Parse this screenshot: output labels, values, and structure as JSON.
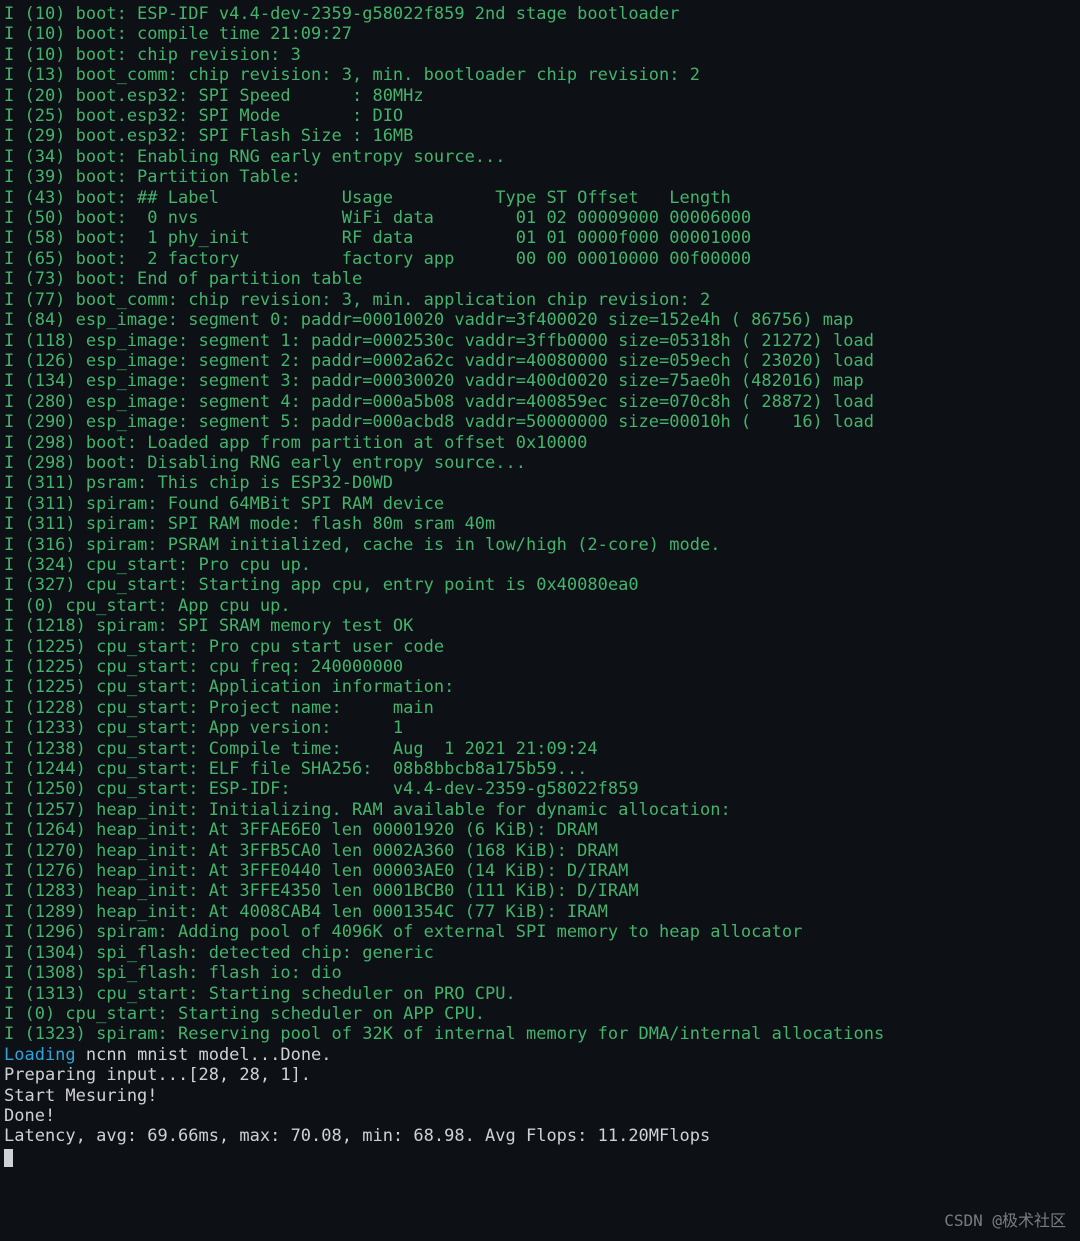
{
  "watermark": "CSDN @极术社区",
  "log": [
    {
      "c": "info",
      "t": "I (10) boot: ESP-IDF v4.4-dev-2359-g58022f859 2nd stage bootloader"
    },
    {
      "c": "info",
      "t": "I (10) boot: compile time 21:09:27"
    },
    {
      "c": "info",
      "t": "I (10) boot: chip revision: 3"
    },
    {
      "c": "info",
      "t": "I (13) boot_comm: chip revision: 3, min. bootloader chip revision: 2"
    },
    {
      "c": "info",
      "t": "I (20) boot.esp32: SPI Speed      : 80MHz"
    },
    {
      "c": "info",
      "t": "I (25) boot.esp32: SPI Mode       : DIO"
    },
    {
      "c": "info",
      "t": "I (29) boot.esp32: SPI Flash Size : 16MB"
    },
    {
      "c": "info",
      "t": "I (34) boot: Enabling RNG early entropy source..."
    },
    {
      "c": "info",
      "t": "I (39) boot: Partition Table:"
    },
    {
      "c": "info",
      "t": "I (43) boot: ## Label            Usage          Type ST Offset   Length"
    },
    {
      "c": "info",
      "t": "I (50) boot:  0 nvs              WiFi data        01 02 00009000 00006000"
    },
    {
      "c": "info",
      "t": "I (58) boot:  1 phy_init         RF data          01 01 0000f000 00001000"
    },
    {
      "c": "info",
      "t": "I (65) boot:  2 factory          factory app      00 00 00010000 00f00000"
    },
    {
      "c": "info",
      "t": "I (73) boot: End of partition table"
    },
    {
      "c": "info",
      "t": "I (77) boot_comm: chip revision: 3, min. application chip revision: 2"
    },
    {
      "c": "info",
      "t": "I (84) esp_image: segment 0: paddr=00010020 vaddr=3f400020 size=152e4h ( 86756) map"
    },
    {
      "c": "info",
      "t": "I (118) esp_image: segment 1: paddr=0002530c vaddr=3ffb0000 size=05318h ( 21272) load"
    },
    {
      "c": "info",
      "t": "I (126) esp_image: segment 2: paddr=0002a62c vaddr=40080000 size=059ech ( 23020) load"
    },
    {
      "c": "info",
      "t": "I (134) esp_image: segment 3: paddr=00030020 vaddr=400d0020 size=75ae0h (482016) map"
    },
    {
      "c": "info",
      "t": "I (280) esp_image: segment 4: paddr=000a5b08 vaddr=400859ec size=070c8h ( 28872) load"
    },
    {
      "c": "info",
      "t": "I (290) esp_image: segment 5: paddr=000acbd8 vaddr=50000000 size=00010h (    16) load"
    },
    {
      "c": "info",
      "t": "I (298) boot: Loaded app from partition at offset 0x10000"
    },
    {
      "c": "info",
      "t": "I (298) boot: Disabling RNG early entropy source..."
    },
    {
      "c": "info",
      "t": "I (311) psram: This chip is ESP32-D0WD"
    },
    {
      "c": "info",
      "t": "I (311) spiram: Found 64MBit SPI RAM device"
    },
    {
      "c": "info",
      "t": "I (311) spiram: SPI RAM mode: flash 80m sram 40m"
    },
    {
      "c": "info",
      "t": "I (316) spiram: PSRAM initialized, cache is in low/high (2-core) mode."
    },
    {
      "c": "info",
      "t": "I (324) cpu_start: Pro cpu up."
    },
    {
      "c": "info",
      "t": "I (327) cpu_start: Starting app cpu, entry point is 0x40080ea0"
    },
    {
      "c": "info",
      "t": "I (0) cpu_start: App cpu up."
    },
    {
      "c": "info",
      "t": "I (1218) spiram: SPI SRAM memory test OK"
    },
    {
      "c": "info",
      "t": "I (1225) cpu_start: Pro cpu start user code"
    },
    {
      "c": "info",
      "t": "I (1225) cpu_start: cpu freq: 240000000"
    },
    {
      "c": "info",
      "t": "I (1225) cpu_start: Application information:"
    },
    {
      "c": "info",
      "t": "I (1228) cpu_start: Project name:     main"
    },
    {
      "c": "info",
      "t": "I (1233) cpu_start: App version:      1"
    },
    {
      "c": "info",
      "t": "I (1238) cpu_start: Compile time:     Aug  1 2021 21:09:24"
    },
    {
      "c": "info",
      "t": "I (1244) cpu_start: ELF file SHA256:  08b8bbcb8a175b59..."
    },
    {
      "c": "info",
      "t": "I (1250) cpu_start: ESP-IDF:          v4.4-dev-2359-g58022f859"
    },
    {
      "c": "info",
      "t": "I (1257) heap_init: Initializing. RAM available for dynamic allocation:"
    },
    {
      "c": "info",
      "t": "I (1264) heap_init: At 3FFAE6E0 len 00001920 (6 KiB): DRAM"
    },
    {
      "c": "info",
      "t": "I (1270) heap_init: At 3FFB5CA0 len 0002A360 (168 KiB): DRAM"
    },
    {
      "c": "info",
      "t": "I (1276) heap_init: At 3FFE0440 len 00003AE0 (14 KiB): D/IRAM"
    },
    {
      "c": "info",
      "t": "I (1283) heap_init: At 3FFE4350 len 0001BCB0 (111 KiB): D/IRAM"
    },
    {
      "c": "info",
      "t": "I (1289) heap_init: At 4008CAB4 len 0001354C (77 KiB): IRAM"
    },
    {
      "c": "info",
      "t": "I (1296) spiram: Adding pool of 4096K of external SPI memory to heap allocator"
    },
    {
      "c": "info",
      "t": "I (1304) spi_flash: detected chip: generic"
    },
    {
      "c": "info",
      "t": "I (1308) spi_flash: flash io: dio"
    },
    {
      "c": "info",
      "t": "I (1313) cpu_start: Starting scheduler on PRO CPU."
    },
    {
      "c": "info",
      "t": "I (0) cpu_start: Starting scheduler on APP CPU."
    },
    {
      "c": "info",
      "t": "I (1323) spiram: Reserving pool of 32K of internal memory for DMA/internal allocations"
    }
  ],
  "tail": {
    "loading": "Loading",
    "loading_rest": " ncnn mnist model...Done.",
    "prep": "Preparing input...[28, 28, 1].",
    "start": "Start Mesuring!",
    "done": "Done!",
    "lat": "Latency, avg: 69.66ms, max: 70.08, min: 68.98. Avg Flops: 11.20MFlops"
  }
}
